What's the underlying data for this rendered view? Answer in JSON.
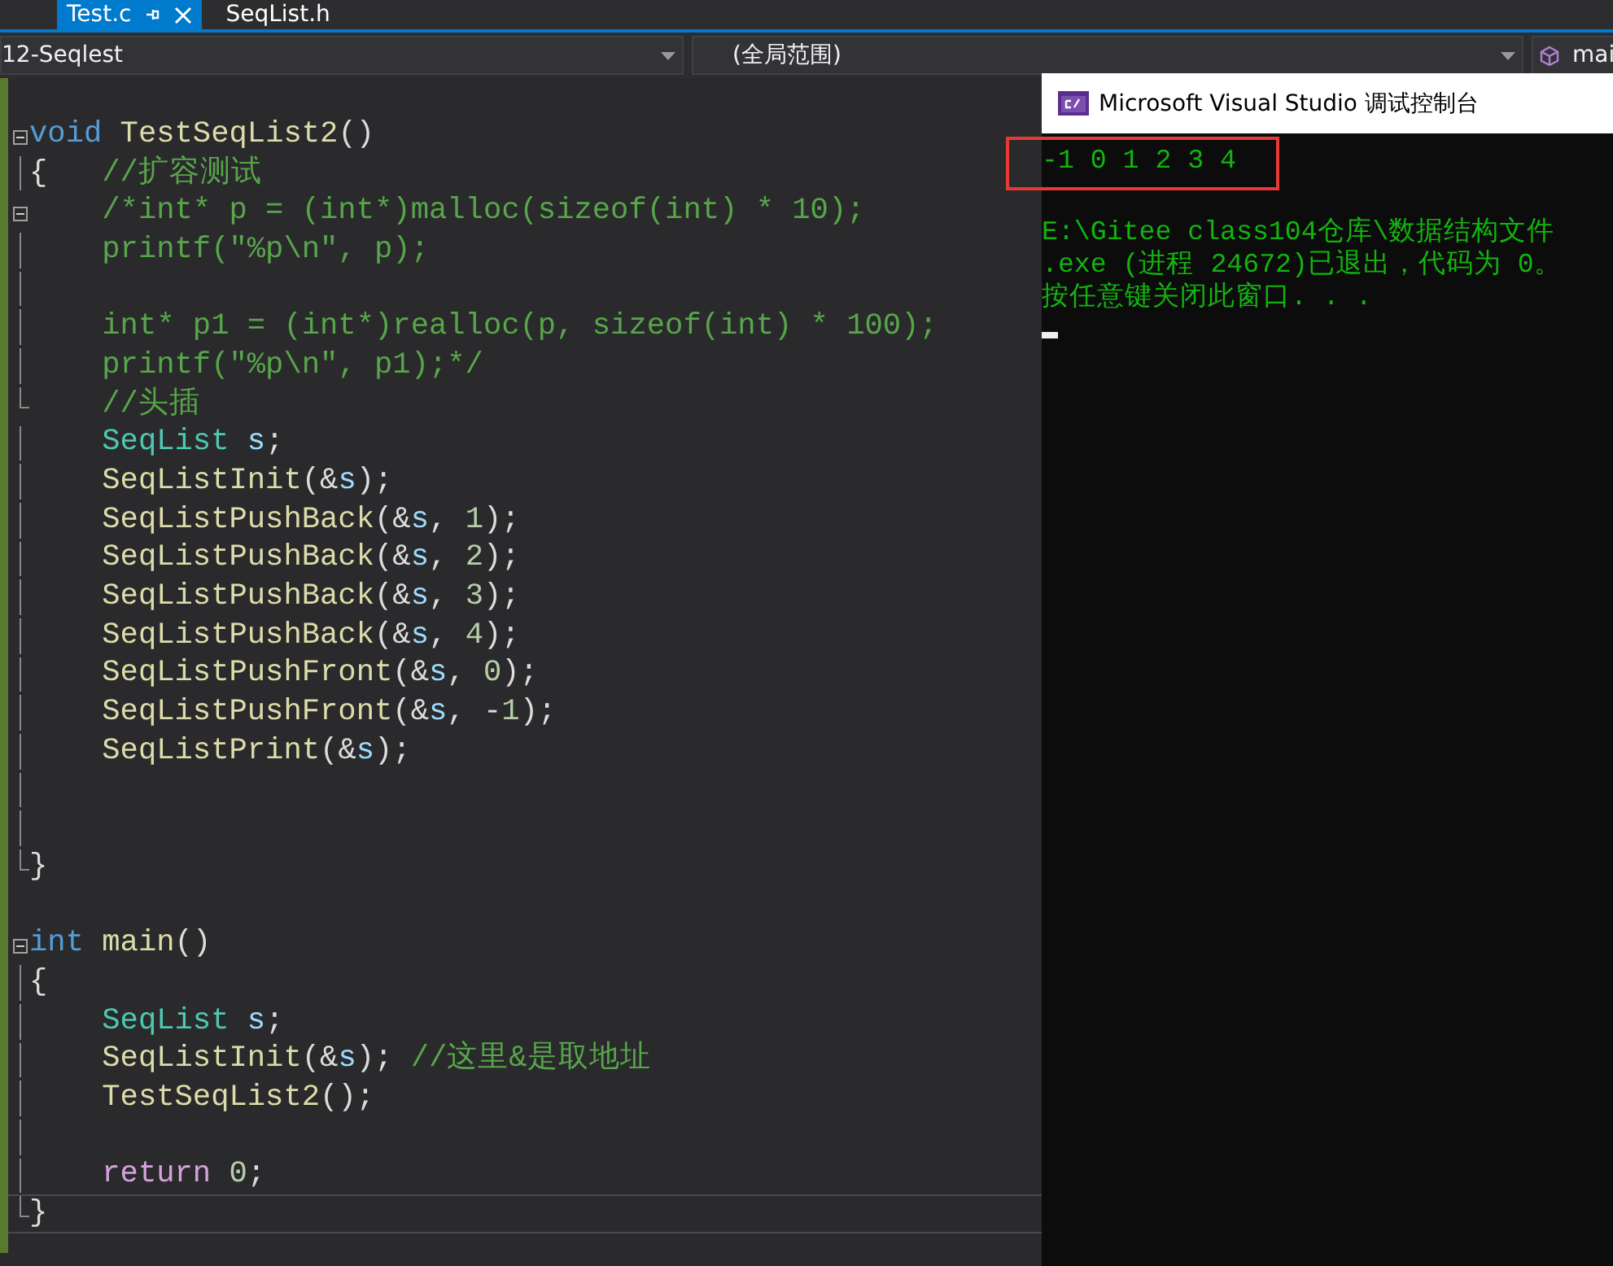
{
  "tabs": [
    {
      "label": "Test.c",
      "selected": true,
      "pinned": true
    },
    {
      "label": "SeqList.h",
      "selected": false,
      "pinned": false
    }
  ],
  "navigation_bar": {
    "project": "12-Seqlest",
    "scope": "(全局范围)",
    "member": "mai"
  },
  "editor": {
    "lines": [
      {
        "kind": "fold_start",
        "current": false,
        "tokens": [
          {
            "kind": "keyword",
            "text": "void"
          },
          {
            "kind": "func",
            "text": " TestSeqList2"
          },
          {
            "kind": "plain",
            "text": "()"
          }
        ]
      },
      {
        "kind": "fold_body",
        "current": false,
        "tokens": [
          {
            "kind": "plain",
            "text": "{"
          },
          {
            "kind": "comment",
            "text": "   //扩容测试"
          }
        ]
      },
      {
        "kind": "fold_start",
        "current": false,
        "tokens": [
          {
            "kind": "comment",
            "text": "    /*int* p = (int*)malloc(sizeof(int) * 10);"
          }
        ]
      },
      {
        "kind": "fold_body",
        "current": false,
        "tokens": [
          {
            "kind": "comment",
            "text": "    printf(\"%p\\n\", p);"
          }
        ]
      },
      {
        "kind": "fold_body",
        "current": false
      },
      {
        "kind": "fold_body",
        "current": false,
        "tokens": [
          {
            "kind": "comment",
            "text": "    int* p1 = (int*)realloc(p, sizeof(int) * 100);"
          }
        ]
      },
      {
        "kind": "fold_body",
        "current": false,
        "tokens": [
          {
            "kind": "comment",
            "text": "    printf(\"%p\\n\", p1);*/"
          }
        ]
      },
      {
        "kind": "fold_end",
        "current": false,
        "tokens": [
          {
            "kind": "comment",
            "text": "    //头插"
          }
        ]
      },
      {
        "kind": "fold_body",
        "current": false,
        "tokens": [
          {
            "kind": "type",
            "text": "    SeqList"
          },
          {
            "kind": "var",
            "text": " s"
          },
          {
            "kind": "plain",
            "text": ";"
          }
        ]
      },
      {
        "kind": "fold_body",
        "current": false,
        "tokens": [
          {
            "kind": "func",
            "text": "    SeqListInit"
          },
          {
            "kind": "plain",
            "text": "(&"
          },
          {
            "kind": "var",
            "text": "s"
          },
          {
            "kind": "plain",
            "text": ");"
          }
        ]
      },
      {
        "kind": "fold_body",
        "current": false,
        "tokens": [
          {
            "kind": "func",
            "text": "    SeqListPushBack"
          },
          {
            "kind": "plain",
            "text": "(&"
          },
          {
            "kind": "var",
            "text": "s"
          },
          {
            "kind": "plain",
            "text": ", "
          },
          {
            "kind": "number",
            "text": "1"
          },
          {
            "kind": "plain",
            "text": ");"
          }
        ]
      },
      {
        "kind": "fold_body",
        "current": false,
        "tokens": [
          {
            "kind": "func",
            "text": "    SeqListPushBack"
          },
          {
            "kind": "plain",
            "text": "(&"
          },
          {
            "kind": "var",
            "text": "s"
          },
          {
            "kind": "plain",
            "text": ", "
          },
          {
            "kind": "number",
            "text": "2"
          },
          {
            "kind": "plain",
            "text": ");"
          }
        ]
      },
      {
        "kind": "fold_body",
        "current": false,
        "tokens": [
          {
            "kind": "func",
            "text": "    SeqListPushBack"
          },
          {
            "kind": "plain",
            "text": "(&"
          },
          {
            "kind": "var",
            "text": "s"
          },
          {
            "kind": "plain",
            "text": ", "
          },
          {
            "kind": "number",
            "text": "3"
          },
          {
            "kind": "plain",
            "text": ");"
          }
        ]
      },
      {
        "kind": "fold_body",
        "current": false,
        "tokens": [
          {
            "kind": "func",
            "text": "    SeqListPushBack"
          },
          {
            "kind": "plain",
            "text": "(&"
          },
          {
            "kind": "var",
            "text": "s"
          },
          {
            "kind": "plain",
            "text": ", "
          },
          {
            "kind": "number",
            "text": "4"
          },
          {
            "kind": "plain",
            "text": ");"
          }
        ]
      },
      {
        "kind": "fold_body",
        "current": false,
        "tokens": [
          {
            "kind": "func",
            "text": "    SeqListPushFront"
          },
          {
            "kind": "plain",
            "text": "(&"
          },
          {
            "kind": "var",
            "text": "s"
          },
          {
            "kind": "plain",
            "text": ", "
          },
          {
            "kind": "number",
            "text": "0"
          },
          {
            "kind": "plain",
            "text": ");"
          }
        ]
      },
      {
        "kind": "fold_body",
        "current": false,
        "tokens": [
          {
            "kind": "func",
            "text": "    SeqListPushFront"
          },
          {
            "kind": "plain",
            "text": "(&"
          },
          {
            "kind": "var",
            "text": "s"
          },
          {
            "kind": "plain",
            "text": ", -"
          },
          {
            "kind": "number",
            "text": "1"
          },
          {
            "kind": "plain",
            "text": ");"
          }
        ]
      },
      {
        "kind": "fold_body",
        "current": false,
        "tokens": [
          {
            "kind": "func",
            "text": "    SeqListPrint"
          },
          {
            "kind": "plain",
            "text": "(&"
          },
          {
            "kind": "var",
            "text": "s"
          },
          {
            "kind": "plain",
            "text": ");"
          }
        ]
      },
      {
        "kind": "fold_body",
        "current": false
      },
      {
        "kind": "fold_body",
        "current": false
      },
      {
        "kind": "fold_end",
        "current": false,
        "tokens": [
          {
            "kind": "plain",
            "text": "}"
          }
        ]
      },
      {
        "kind": "blank",
        "current": false
      },
      {
        "kind": "fold_start",
        "current": false,
        "tokens": [
          {
            "kind": "keyword",
            "text": "int"
          },
          {
            "kind": "func",
            "text": " main"
          },
          {
            "kind": "plain",
            "text": "()"
          }
        ]
      },
      {
        "kind": "fold_body",
        "current": false,
        "tokens": [
          {
            "kind": "plain",
            "text": "{"
          }
        ]
      },
      {
        "kind": "fold_body",
        "current": false,
        "tokens": [
          {
            "kind": "type",
            "text": "    SeqList"
          },
          {
            "kind": "var",
            "text": " s"
          },
          {
            "kind": "plain",
            "text": ";"
          }
        ]
      },
      {
        "kind": "fold_body",
        "current": false,
        "tokens": [
          {
            "kind": "func",
            "text": "    SeqListInit"
          },
          {
            "kind": "plain",
            "text": "(&"
          },
          {
            "kind": "var",
            "text": "s"
          },
          {
            "kind": "plain",
            "text": ");"
          },
          {
            "kind": "comment",
            "text": " //这里&是取地址"
          }
        ]
      },
      {
        "kind": "fold_body",
        "current": false,
        "tokens": [
          {
            "kind": "func",
            "text": "    TestSeqList2"
          },
          {
            "kind": "plain",
            "text": "();"
          }
        ]
      },
      {
        "kind": "fold_body",
        "current": false
      },
      {
        "kind": "fold_body",
        "current": false,
        "tokens": [
          {
            "kind": "control",
            "text": "    return"
          },
          {
            "kind": "number",
            "text": " 0"
          },
          {
            "kind": "plain",
            "text": ";"
          }
        ]
      },
      {
        "kind": "fold_end",
        "current": true,
        "tokens": [
          {
            "kind": "plain",
            "text": "}"
          }
        ]
      }
    ]
  },
  "console": {
    "title": "Microsoft Visual Studio 调试控制台",
    "lines": [
      {
        "text": "-1 0 1 2 3 4",
        "highlighted": true
      },
      {
        "text": "E:\\Gitee class104仓库\\数据结构文件",
        "highlighted": false
      },
      {
        "text": ".exe (进程 24672)已退出，代码为 0。",
        "highlighted": false
      },
      {
        "text": "按任意键关闭此窗口. . .",
        "highlighted": false
      }
    ]
  }
}
